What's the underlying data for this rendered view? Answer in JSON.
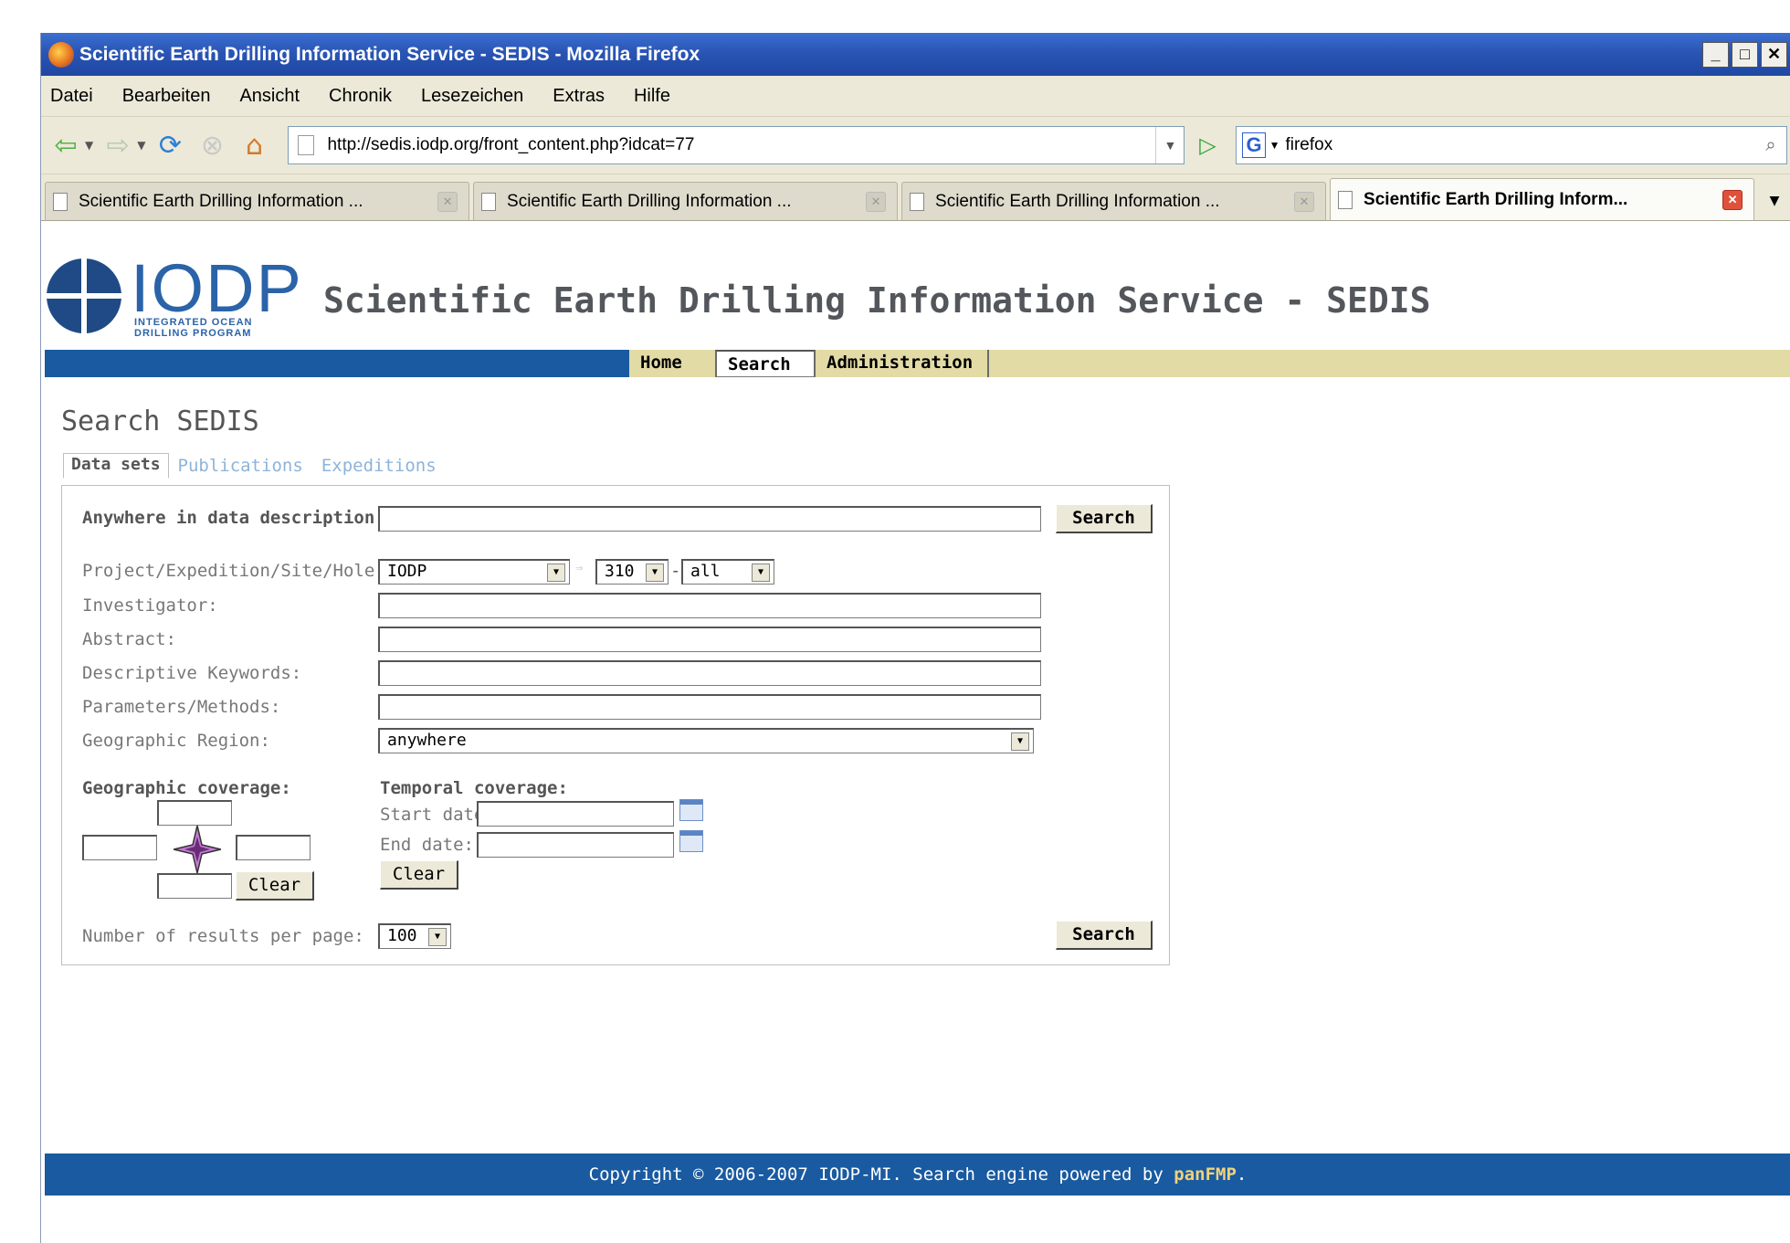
{
  "window": {
    "title": "Scientific Earth Drilling Information Service - SEDIS - Mozilla Firefox"
  },
  "menu": [
    "Datei",
    "Bearbeiten",
    "Ansicht",
    "Chronik",
    "Lesezeichen",
    "Extras",
    "Hilfe"
  ],
  "toolbar": {
    "url": "http://sedis.iodp.org/front_content.php?idcat=77",
    "search_value": "firefox"
  },
  "tabs": [
    {
      "label": "Scientific Earth Drilling Information ..."
    },
    {
      "label": "Scientific Earth Drilling Information ..."
    },
    {
      "label": "Scientific Earth Drilling Information ..."
    },
    {
      "label": "Scientific Earth Drilling Inform..."
    }
  ],
  "site": {
    "logo_text": "IODP",
    "logo_sub": "INTEGRATED OCEAN DRILLING PROGRAM",
    "title": "Scientific Earth Drilling Information Service - SEDIS",
    "nav": [
      "Home",
      "Search",
      "Administration"
    ]
  },
  "search": {
    "heading": "Search SEDIS",
    "tabs": [
      "Data sets",
      "Publications",
      "Expeditions"
    ],
    "anywhere_label": "Anywhere in data description",
    "anywhere_colon": ":",
    "search_button": "Search",
    "project_label": "Project/Expedition/Site/Hole:",
    "project_value": "IODP",
    "expedition_value": "310",
    "site_value": "all",
    "investigator_label": "Investigator:",
    "abstract_label": "Abstract:",
    "keywords_label": "Descriptive Keywords:",
    "params_label": "Parameters/Methods:",
    "region_label": "Geographic Region:",
    "region_value": "anywhere",
    "geo_label": "Geographic coverage:",
    "temporal_label": "Temporal coverage:",
    "start_label": "Start date:",
    "end_label": "End date:",
    "clear_button": "Clear",
    "results_label": "Number of results per page:",
    "results_value": "100"
  },
  "footer": {
    "text": "Copyright © 2006-2007 IODP-MI. Search engine powered by ",
    "link": "panFMP",
    "end": "."
  }
}
